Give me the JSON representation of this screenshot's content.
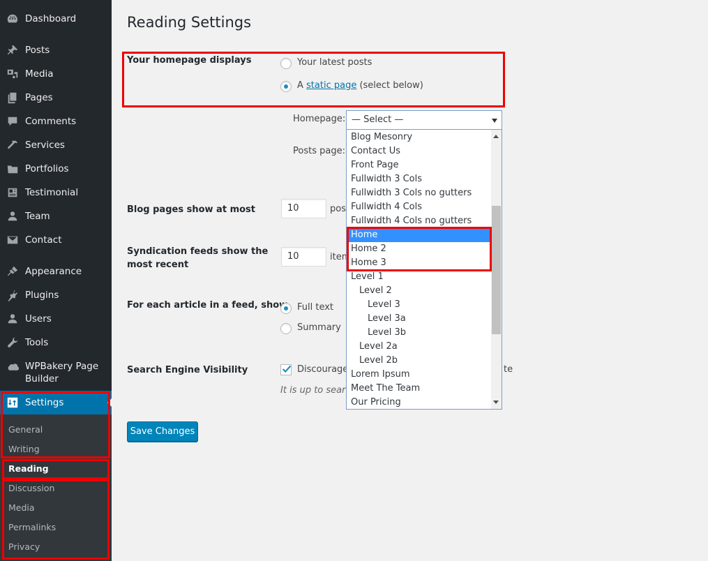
{
  "sidebar": {
    "items": [
      {
        "label": "Dashboard",
        "icon": "dashboard-icon"
      },
      {
        "label": "Posts",
        "icon": "pin-icon"
      },
      {
        "label": "Media",
        "icon": "media-icon"
      },
      {
        "label": "Pages",
        "icon": "pages-icon"
      },
      {
        "label": "Comments",
        "icon": "comment-icon"
      },
      {
        "label": "Services",
        "icon": "hammer-icon"
      },
      {
        "label": "Portfolios",
        "icon": "folder-icon"
      },
      {
        "label": "Testimonial",
        "icon": "id-card-icon"
      },
      {
        "label": "Team",
        "icon": "person-icon"
      },
      {
        "label": "Contact",
        "icon": "envelope-icon"
      },
      {
        "label": "Appearance",
        "icon": "paintbrush-icon"
      },
      {
        "label": "Plugins",
        "icon": "plug-icon"
      },
      {
        "label": "Users",
        "icon": "users-icon"
      },
      {
        "label": "Tools",
        "icon": "wrench-icon"
      },
      {
        "label": "WPBakery Page Builder",
        "icon": "cloud-icon"
      }
    ],
    "settings": {
      "label": "Settings",
      "icon": "sliders-icon"
    },
    "submenu": [
      {
        "label": "General"
      },
      {
        "label": "Writing"
      },
      {
        "label": "Reading",
        "current": true
      },
      {
        "label": "Discussion"
      },
      {
        "label": "Media"
      },
      {
        "label": "Permalinks"
      },
      {
        "label": "Privacy"
      }
    ]
  },
  "main": {
    "title": "Reading Settings",
    "homepage_displays": {
      "label": "Your homepage displays",
      "option_latest": "Your latest posts",
      "option_static_prefix": "A ",
      "option_static_link": "static page",
      "option_static_suffix": " (select below)",
      "selected": "static"
    },
    "homepage_field": {
      "label": "Homepage:",
      "value": "— Select —"
    },
    "posts_page_field": {
      "label": "Posts page:"
    },
    "dropdown_options": [
      {
        "label": "Blog Mesonry",
        "level": 0
      },
      {
        "label": "Contact Us",
        "level": 0
      },
      {
        "label": "Front Page",
        "level": 0
      },
      {
        "label": "Fullwidth 3 Cols",
        "level": 0
      },
      {
        "label": "Fullwidth 3 Cols no gutters",
        "level": 0
      },
      {
        "label": "Fullwidth 4 Cols",
        "level": 0
      },
      {
        "label": "Fullwidth 4 Cols no gutters",
        "level": 0
      },
      {
        "label": "Home",
        "level": 0,
        "highlighted": true
      },
      {
        "label": "Home 2",
        "level": 0
      },
      {
        "label": "Home 3",
        "level": 0
      },
      {
        "label": "Level 1",
        "level": 0
      },
      {
        "label": "Level 2",
        "level": 1
      },
      {
        "label": "Level 3",
        "level": 2
      },
      {
        "label": "Level 3a",
        "level": 2
      },
      {
        "label": "Level 3b",
        "level": 2
      },
      {
        "label": "Level 2a",
        "level": 1
      },
      {
        "label": "Level 2b",
        "level": 1
      },
      {
        "label": "Lorem Ipsum",
        "level": 0
      },
      {
        "label": "Meet The Team",
        "level": 0
      },
      {
        "label": "Our Pricing",
        "level": 0
      }
    ],
    "blog_pages": {
      "label": "Blog pages show at most",
      "value": "10",
      "suffix": "pos"
    },
    "syndication": {
      "label_line1": "Syndication feeds show the",
      "label_line2": "most recent",
      "value": "10",
      "suffix": "item"
    },
    "feed_article": {
      "label": "For each article in a feed, show",
      "option_full": "Full text",
      "option_summary": "Summary",
      "selected": "full"
    },
    "search_visibility": {
      "label": "Search Engine Visibility",
      "checkbox_label_visible": "Discourage",
      "checkbox_label_tail": "te",
      "checked": true,
      "description": "It is up to search"
    },
    "save_button": "Save Changes"
  },
  "colors": {
    "sidebar_bg": "#23282d",
    "submenu_bg": "#32373c",
    "active_bg": "#0073aa",
    "button_bg": "#0085ba",
    "highlight": "#3390ff",
    "annotation_red": "#ee0000"
  }
}
